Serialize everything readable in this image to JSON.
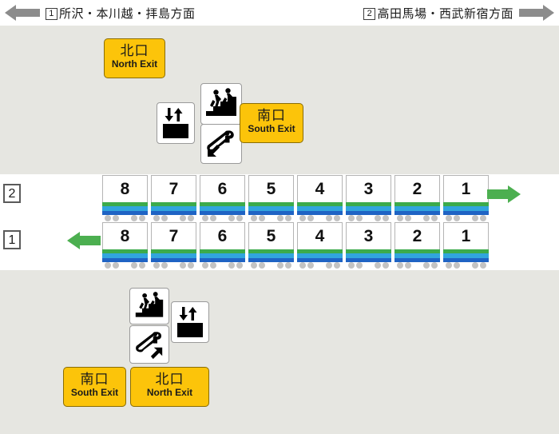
{
  "header": {
    "left": {
      "arrow_icon": "arrow-left-gray",
      "platform_number": "1",
      "text": "所沢・本川越・拝島方面"
    },
    "right": {
      "arrow_icon": "arrow-right-gray",
      "platform_number": "2",
      "text": "高田馬場・西武新宿方面"
    }
  },
  "colors": {
    "concourse": "#e6e6e1",
    "platform": "#ffffff",
    "exit_sign": "#fcc40a",
    "direction_arrow": "#4caf50",
    "car_green": "#3cab4b",
    "car_cyan": "#31a5dd",
    "car_blue": "#1f63c4"
  },
  "upper_concourse": {
    "north_exit": {
      "jp": "北口",
      "en": "North Exit"
    },
    "south_exit": {
      "jp": "南口",
      "en": "South Exit"
    },
    "icons": [
      {
        "name": "elevator-icon",
        "label": "Elevator"
      },
      {
        "name": "stairs-icon",
        "label": "Stairs"
      },
      {
        "name": "escalator-icon",
        "label": "Escalator"
      }
    ]
  },
  "lower_concourse": {
    "south_exit": {
      "jp": "南口",
      "en": "South Exit"
    },
    "north_exit": {
      "jp": "北口",
      "en": "North Exit"
    },
    "icons": [
      {
        "name": "stairs-icon",
        "label": "Stairs"
      },
      {
        "name": "escalator-icon",
        "label": "Escalator"
      },
      {
        "name": "elevator-icon",
        "label": "Elevator"
      }
    ]
  },
  "platforms": [
    {
      "number": "2",
      "direction": "right",
      "arrow_icon": "arrow-right-green",
      "cars": [
        "8",
        "7",
        "6",
        "5",
        "4",
        "3",
        "2",
        "1"
      ]
    },
    {
      "number": "1",
      "direction": "left",
      "arrow_icon": "arrow-left-green",
      "cars": [
        "8",
        "7",
        "6",
        "5",
        "4",
        "3",
        "2",
        "1"
      ]
    }
  ]
}
